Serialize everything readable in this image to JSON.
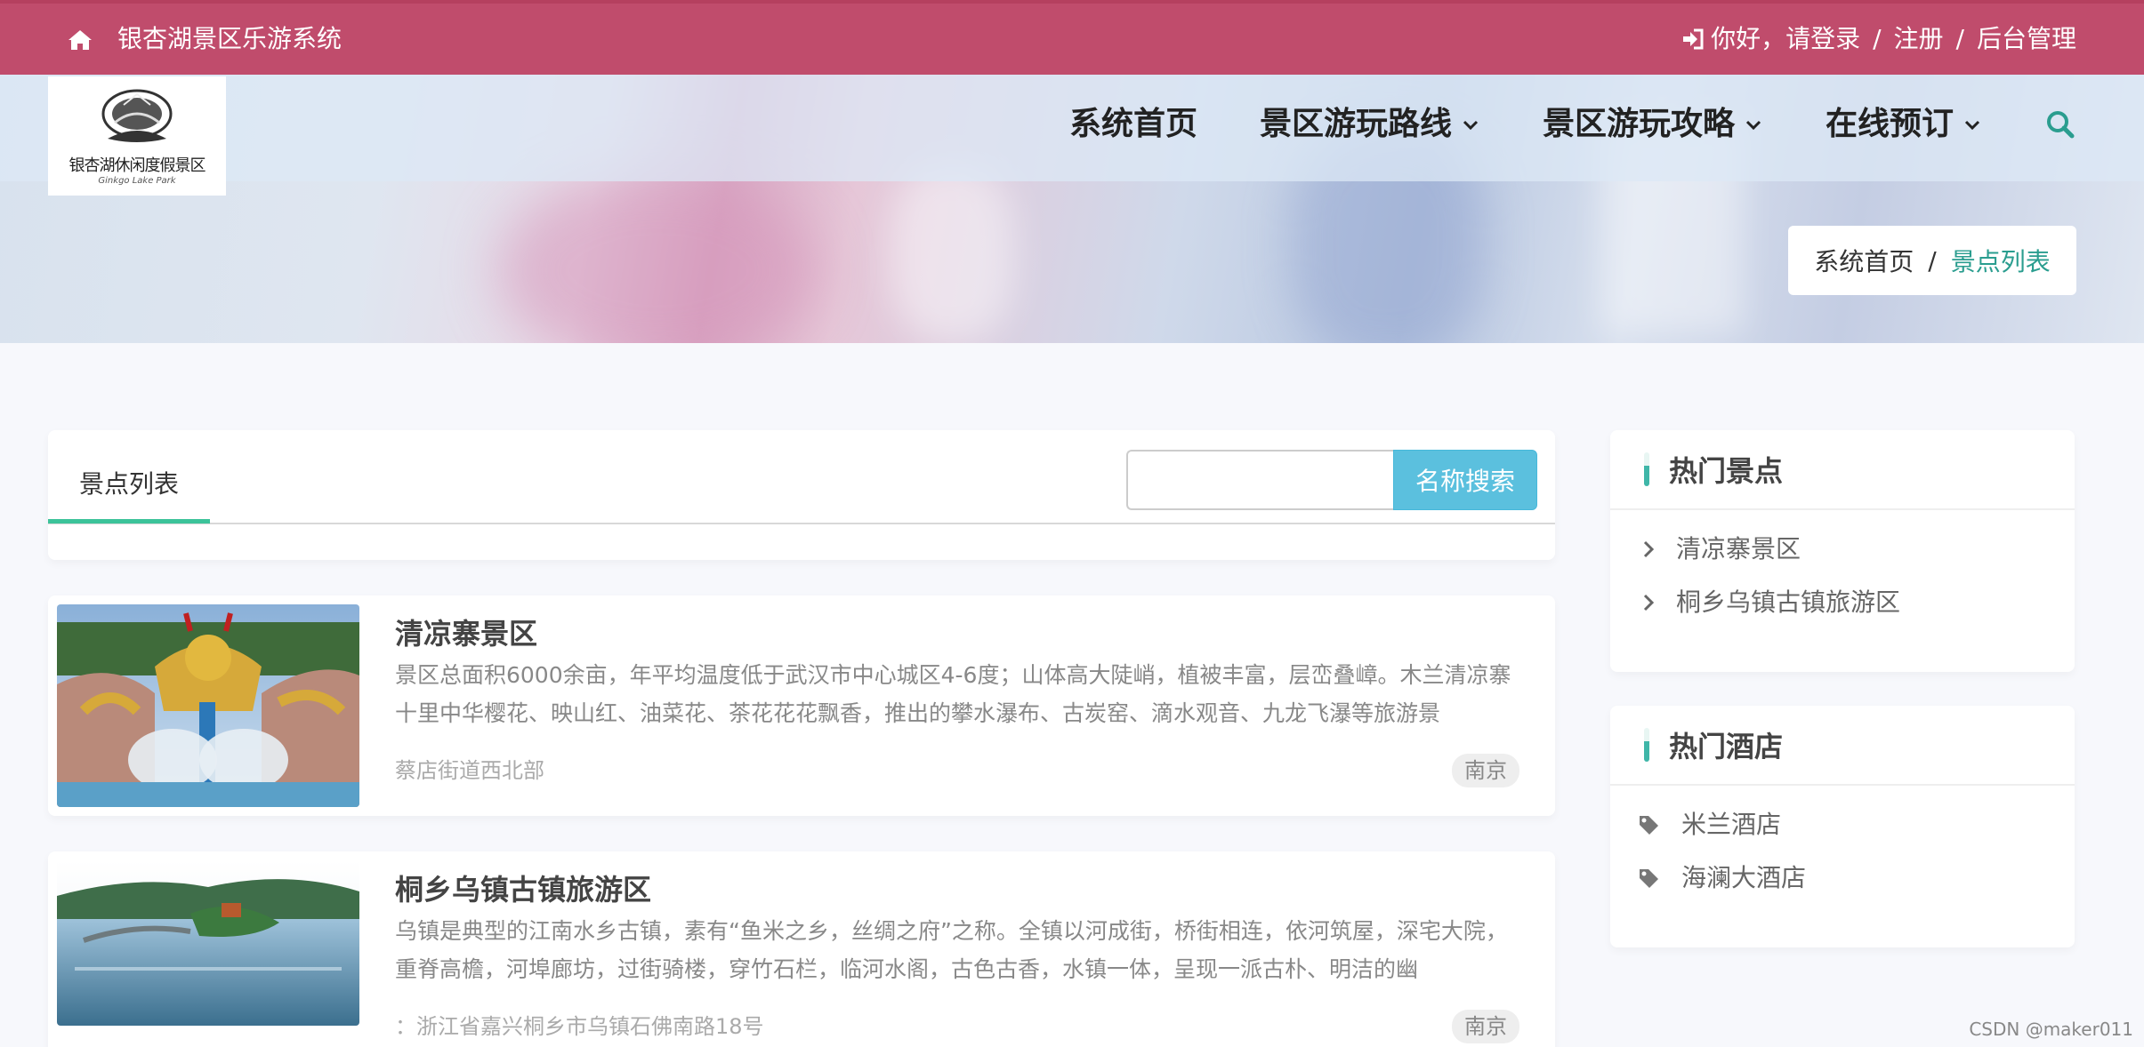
{
  "topbar": {
    "site_title": "银杏湖景区乐游系统",
    "greeting": "你好，请登录",
    "sep": "/",
    "register": "注册",
    "admin": "后台管理"
  },
  "logo": {
    "text": "银杏湖休闲度假景区",
    "sub": "Ginkgo Lake Park"
  },
  "nav": {
    "home": "系统首页",
    "routes": "景区游玩路线",
    "guides": "景区游玩攻略",
    "booking": "在线预订"
  },
  "breadcrumb": {
    "home": "系统首页",
    "sep": "/",
    "current": "景点列表"
  },
  "list": {
    "tab": "景点列表",
    "search_placeholder": "",
    "search_button": "名称搜索",
    "items": [
      {
        "title": "清凉寨景区",
        "desc": "景区总面积6000余亩，年平均温度低于武汉市中心城区4-6度；山体高大陡峭，植被丰富，层峦叠嶂。木兰清凉寨十里中华樱花、映山红、油菜花、茶花花花飘香，推出的攀水瀑布、古炭窑、滴水观音、九龙飞瀑等旅游景",
        "addr": "蔡店街道西北部",
        "city": "南京"
      },
      {
        "title": "桐乡乌镇古镇旅游区",
        "desc": "乌镇是典型的江南水乡古镇，素有“鱼米之乡，丝绸之府”之称。全镇以河成街，桥街相连，依河筑屋，深宅大院，重脊高檐，河埠廊坊，过街骑楼，穿竹石栏，临河水阁，古色古香，水镇一体，呈现一派古朴、明洁的幽",
        "addr": "：浙江省嘉兴桐乡市乌镇石佛南路18号",
        "city": "南京"
      }
    ]
  },
  "hot_spots": {
    "title": "热门景点",
    "items": [
      "清凉寨景区",
      "桐乡乌镇古镇旅游区"
    ]
  },
  "hot_hotels": {
    "title": "热门酒店",
    "items": [
      "米兰酒店",
      "海澜大酒店"
    ]
  },
  "watermark": "CSDN @maker011",
  "colors": {
    "topbar": "#c04c6c",
    "accent": "#2a9d8f",
    "search_button": "#5bc0de",
    "tab_underline": "#3cc39a"
  }
}
